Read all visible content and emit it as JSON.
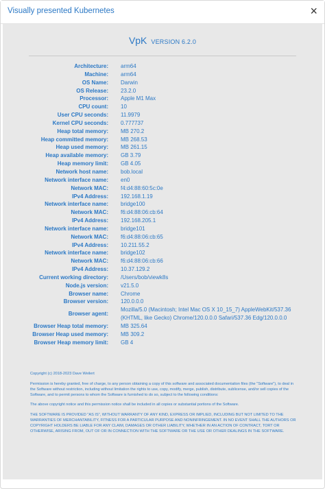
{
  "window": {
    "title": "Visually presented Kubernetes",
    "close_label": "×"
  },
  "header": {
    "app_name": "VpK",
    "version": "VERSION 6.2.0"
  },
  "info_rows": [
    {
      "label": "Architecture:",
      "value": "arm64"
    },
    {
      "label": "Machine:",
      "value": "arm64"
    },
    {
      "label": "OS Name:",
      "value": "Darwin"
    },
    {
      "label": "OS Release:",
      "value": "23.2.0"
    },
    {
      "label": "Processor:",
      "value": "Apple M1 Max"
    },
    {
      "label": "CPU count:",
      "value": "10"
    },
    {
      "label": "User CPU seconds:",
      "value": "11.9979"
    },
    {
      "label": "Kernel CPU seconds:",
      "value": "0.777737"
    },
    {
      "label": "Heap total memory:",
      "value": "MB 270.2"
    },
    {
      "label": "Heap committed memory:",
      "value": "MB 268.53"
    },
    {
      "label": "Heap used memory:",
      "value": "MB 261.15"
    },
    {
      "label": "Heap available memory:",
      "value": "GB 3.79"
    },
    {
      "label": "Heap memory limit:",
      "value": "GB 4.05"
    },
    {
      "label": "Network host name:",
      "value": "bob.local"
    },
    {
      "label": "Network interface name:",
      "value": "en0"
    },
    {
      "label": "Network MAC:",
      "value": "f4:d4:88:60:5c:0e"
    },
    {
      "label": "IPv4 Address:",
      "value": "192.168.1.19"
    },
    {
      "label": "Network interface name:",
      "value": "bridge100"
    },
    {
      "label": "Network MAC:",
      "value": "f6:d4:88:06:cb:64"
    },
    {
      "label": "IPv4 Address:",
      "value": "192.168.205.1"
    },
    {
      "label": "Network interface name:",
      "value": "bridge101"
    },
    {
      "label": "Network MAC:",
      "value": "f6:d4:88:06:cb:65"
    },
    {
      "label": "IPv4 Address:",
      "value": "10.211.55.2"
    },
    {
      "label": "Network interface name:",
      "value": "bridge102"
    },
    {
      "label": "Network MAC:",
      "value": "f6:d4:88:06:cb:66"
    },
    {
      "label": "IPv4 Address:",
      "value": "10.37.129.2"
    },
    {
      "label": "Current working directory:",
      "value": "/Users/bob/viewk8s"
    },
    {
      "label": "Node.js version:",
      "value": "v21.5.0"
    },
    {
      "label": "Browser name:",
      "value": "Chrome"
    },
    {
      "label": "Browser version:",
      "value": "120.0.0.0"
    },
    {
      "label": "Browser agent:",
      "value": "Mozilla/5.0 (Macintosh; Intel Mac OS X 10_15_7) AppleWebKit/537.36 (KHTML, like Gecko) Chrome/120.0.0.0 Safari/537.36 Edg/120.0.0.0"
    },
    {
      "label": "Browser Heap total memory:",
      "value": "MB 325.64"
    },
    {
      "label": "Browser Heap used memory:",
      "value": "MB 309.2"
    },
    {
      "label": "Browser Heap memory limit:",
      "value": "GB 4"
    }
  ],
  "legal": {
    "copyright": "Copyright (c) 2018-2023 Dave Weilert",
    "permission": "Permission is hereby granted, free of charge, to any person obtaining a copy of this software and associated documentation files (the \"Software\"), to deal in the Software without restriction, including without limitation the rights to use, copy, modify, merge, publish, distribute, sublicense, and/or sell copies of the Software, and to permit persons to whom the Software is furnished to do so, subject to the following conditions:",
    "notice": "The above copyright notice and this permission notice shall be included in all copies or substantial portions of the Software.",
    "warranty": "THE SOFTWARE IS PROVIDED \"AS IS\", WITHOUT WARRANTY OF ANY KIND, EXPRESS OR IMPLIED, INCLUDING BUT NOT LIMITED TO THE WARRANTIES OF MERCHANTABILITY, FITNESS FOR A PARTICULAR PURPOSE AND NONINFRINGEMENT. IN NO EVENT SHALL THE AUTHORS OR COPYRIGHT HOLDERS BE LIABLE FOR ANY CLAIM, DAMAGES OR OTHER LIABILITY, WHETHER IN AN ACTION OF CONTRACT, TORT OR OTHERWISE, ARISING FROM, OUT OF OR IN CONNECTION WITH THE SOFTWARE OR THE USE OR OTHER DEALINGS IN THE SOFTWARE."
  },
  "colors": {
    "accent": "#2b78c5",
    "panel_bg": "#e8e8e8"
  }
}
